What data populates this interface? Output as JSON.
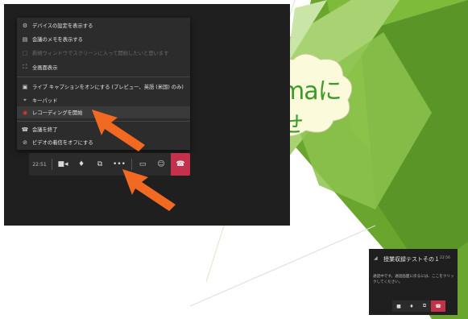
{
  "menu": {
    "items": [
      {
        "icon": "gear-icon",
        "glyph": "⚙",
        "label": "デバイスの設定を表示する"
      },
      {
        "icon": "notes-icon",
        "glyph": "▤",
        "label": "会議のメモを表示する"
      },
      {
        "icon": "window-icon",
        "glyph": "▢",
        "label": "新規ウィンドウでスクリーンに入って開始したいと思います"
      },
      {
        "icon": "fullscreen-icon",
        "glyph": "⛶",
        "label": "全画面表示"
      },
      {
        "icon": "captions-icon",
        "glyph": "▣",
        "label": "ライブ キャプションをオンにする (プレビュー、英語 (米国) のみ)"
      },
      {
        "icon": "keypad-icon",
        "glyph": "⌖",
        "label": "キーパッド"
      },
      {
        "icon": "record-icon",
        "glyph": "◉",
        "label": "レコーディングを開始"
      },
      {
        "icon": "end-meeting-icon",
        "glyph": "☎",
        "label": "会議を終了"
      },
      {
        "icon": "video-off-icon",
        "glyph": "⊘",
        "label": "ビデオの着信をオフにする"
      }
    ]
  },
  "toolbar": {
    "time": "22:51",
    "buttons": [
      {
        "icon": "camera-icon",
        "glyph": "■"
      },
      {
        "icon": "microphone-icon",
        "glyph": "🎤"
      },
      {
        "icon": "share-screen-icon",
        "glyph": "⧉"
      },
      {
        "icon": "more-options-icon",
        "glyph": "•••"
      },
      {
        "icon": "chat-icon",
        "glyph": "▭"
      },
      {
        "icon": "participants-icon",
        "glyph": "☺"
      },
      {
        "icon": "hang-up-icon",
        "glyph": "☎"
      }
    ]
  },
  "slide": {
    "line1": "maに",
    "line2": "せ"
  },
  "mini_window": {
    "title": "授業収録テストその１",
    "time": "22:56",
    "message": "通話中です。通話画面に戻るには、ここをクリックしてください。"
  },
  "colors": {
    "accent_red": "#c4314b",
    "arrow_orange": "#f26a21",
    "slide_green": "#3a9a2a"
  }
}
